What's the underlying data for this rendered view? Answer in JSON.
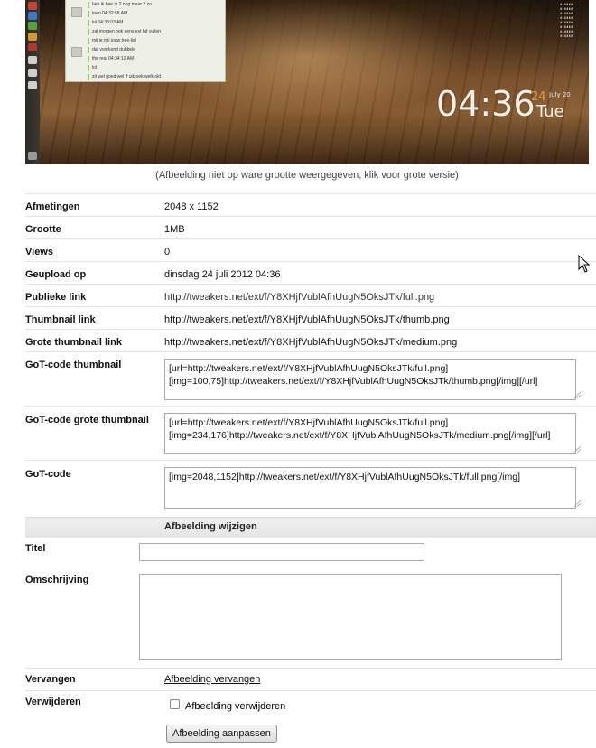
{
  "preview": {
    "clock_time": "04:36",
    "clock_day": "24",
    "clock_month": "July 20",
    "clock_weekday": "Tue",
    "chat_messages": [
      "heb ik hier in 2 nog maar 2 zo",
      "toeri 04:32:58 AM",
      "lol 04:33:03 AM",
      "zal morgen ook eens ext hd vullen",
      "mij je mij jouw tree-list",
      "dat voorkomt dubbele",
      "the real 04:34:12 AM",
      "lol",
      "zit wel goed wel ff uitzoek welk old"
    ],
    "caption": "(Afbeelding niet op ware grootte weergegeven, klik voor grote versie)"
  },
  "details": {
    "dimensions_label": "Afmetingen",
    "dimensions_value": "2048 x 1152",
    "size_label": "Grootte",
    "size_value": "1MB",
    "views_label": "Views",
    "views_value": "0",
    "uploaded_label": "Geupload op",
    "uploaded_value": "dinsdag 24 juli 2012 04:36",
    "public_link_label": "Publieke link",
    "public_link_value": "http://tweakers.net/ext/f/Y8XHjfVublAfhUugN5OksJTk/full.png",
    "thumb_link_label": "Thumbnail link",
    "thumb_link_value": "http://tweakers.net/ext/f/Y8XHjfVublAfhUugN5OksJTk/thumb.png",
    "big_thumb_link_label": "Grote thumbnail link",
    "big_thumb_link_value": "http://tweakers.net/ext/f/Y8XHjfVublAfhUugN5OksJTk/medium.png",
    "got_thumb_label": "GoT-code thumbnail",
    "got_thumb_value": "[url=http://tweakers.net/ext/f/Y8XHjfVublAfhUugN5OksJTk/full.png]\n[img=100,75]http://tweakers.net/ext/f/Y8XHjfVublAfhUugN5OksJTk/thumb.png[/img][/url]",
    "got_big_thumb_label": "GoT-code grote thumbnail",
    "got_big_thumb_value": "[url=http://tweakers.net/ext/f/Y8XHjfVublAfhUugN5OksJTk/full.png]\n[img=234,176]http://tweakers.net/ext/f/Y8XHjfVublAfhUugN5OksJTk/medium.png[/img][/url]",
    "got_label": "GoT-code",
    "got_value": "[img=2048,1152]http://tweakers.net/ext/f/Y8XHjfVublAfhUugN5OksJTk/full.png[/img]"
  },
  "edit": {
    "section_title": "Afbeelding wijzigen",
    "title_label": "Titel",
    "title_value": "",
    "description_label": "Omschrijving",
    "description_value": "",
    "replace_label": "Vervangen",
    "replace_link": "Afbeelding vervangen",
    "delete_label": "Verwijderen",
    "delete_checkbox_label": "Afbeelding verwijderen",
    "submit_label": "Afbeelding aanpassen"
  },
  "colors": {
    "clock_accent": "#e89a3a",
    "section_bg": "#e4e4e4"
  }
}
